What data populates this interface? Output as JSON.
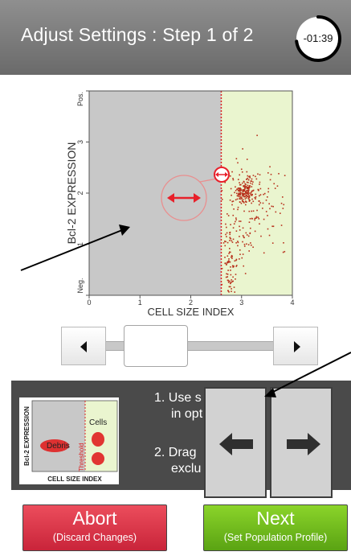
{
  "header": {
    "title": "Adjust Settings : Step 1 of 2",
    "timer": "-01:39",
    "timer_fraction_remaining": 0.73
  },
  "chart_data": {
    "type": "scatter",
    "xlabel": "CELL SIZE INDEX",
    "ylabel": "Bcl-2 EXPRESSION",
    "x_ticks": [
      "0",
      "1",
      "2",
      "3",
      "4"
    ],
    "y_ticks": [
      "Neg.",
      "1",
      "2",
      "3",
      "Pos."
    ],
    "xlim": [
      0,
      4
    ],
    "ylim": [
      0,
      4
    ],
    "threshold_x": 2.6,
    "regions": {
      "debris_color": "#c8c8c8",
      "cells_color": "#eaf5cf"
    },
    "clusters": [
      {
        "cx": 3.05,
        "cy": 2.05,
        "sx": 0.12,
        "sy": 0.13,
        "count": 170
      },
      {
        "cx": 3.2,
        "cy": 1.85,
        "sx": 0.35,
        "sy": 0.42,
        "count": 140
      },
      {
        "cx": 2.75,
        "cy": 0.5,
        "sx": 0.1,
        "sy": 0.35,
        "count": 90
      },
      {
        "cx": 3.0,
        "cy": 1.2,
        "sx": 0.3,
        "sy": 0.3,
        "count": 45
      }
    ],
    "dot_color": "#b8321d"
  },
  "slider": {
    "position": 0.17
  },
  "legend": {
    "ylabel": "Bcl-2 EXPRESSION",
    "xlabel": "CELL SIZE INDEX",
    "debris": "Debris",
    "cells": "Cells",
    "threshold": "Threshold"
  },
  "instructions": {
    "step1_line1": "1. Use s",
    "step1_line2": "in opt",
    "step2_line1": "2. Drag",
    "step2_line2": "exclu"
  },
  "buttons": {
    "abort_label": "Abort",
    "abort_sub": "(Discard Changes)",
    "next_label": "Next",
    "next_sub": "(Set Population Profile)"
  },
  "colors": {
    "accent_red": "#e8202a",
    "next_green": "#6fbe1c",
    "abort_red": "#e03448"
  }
}
